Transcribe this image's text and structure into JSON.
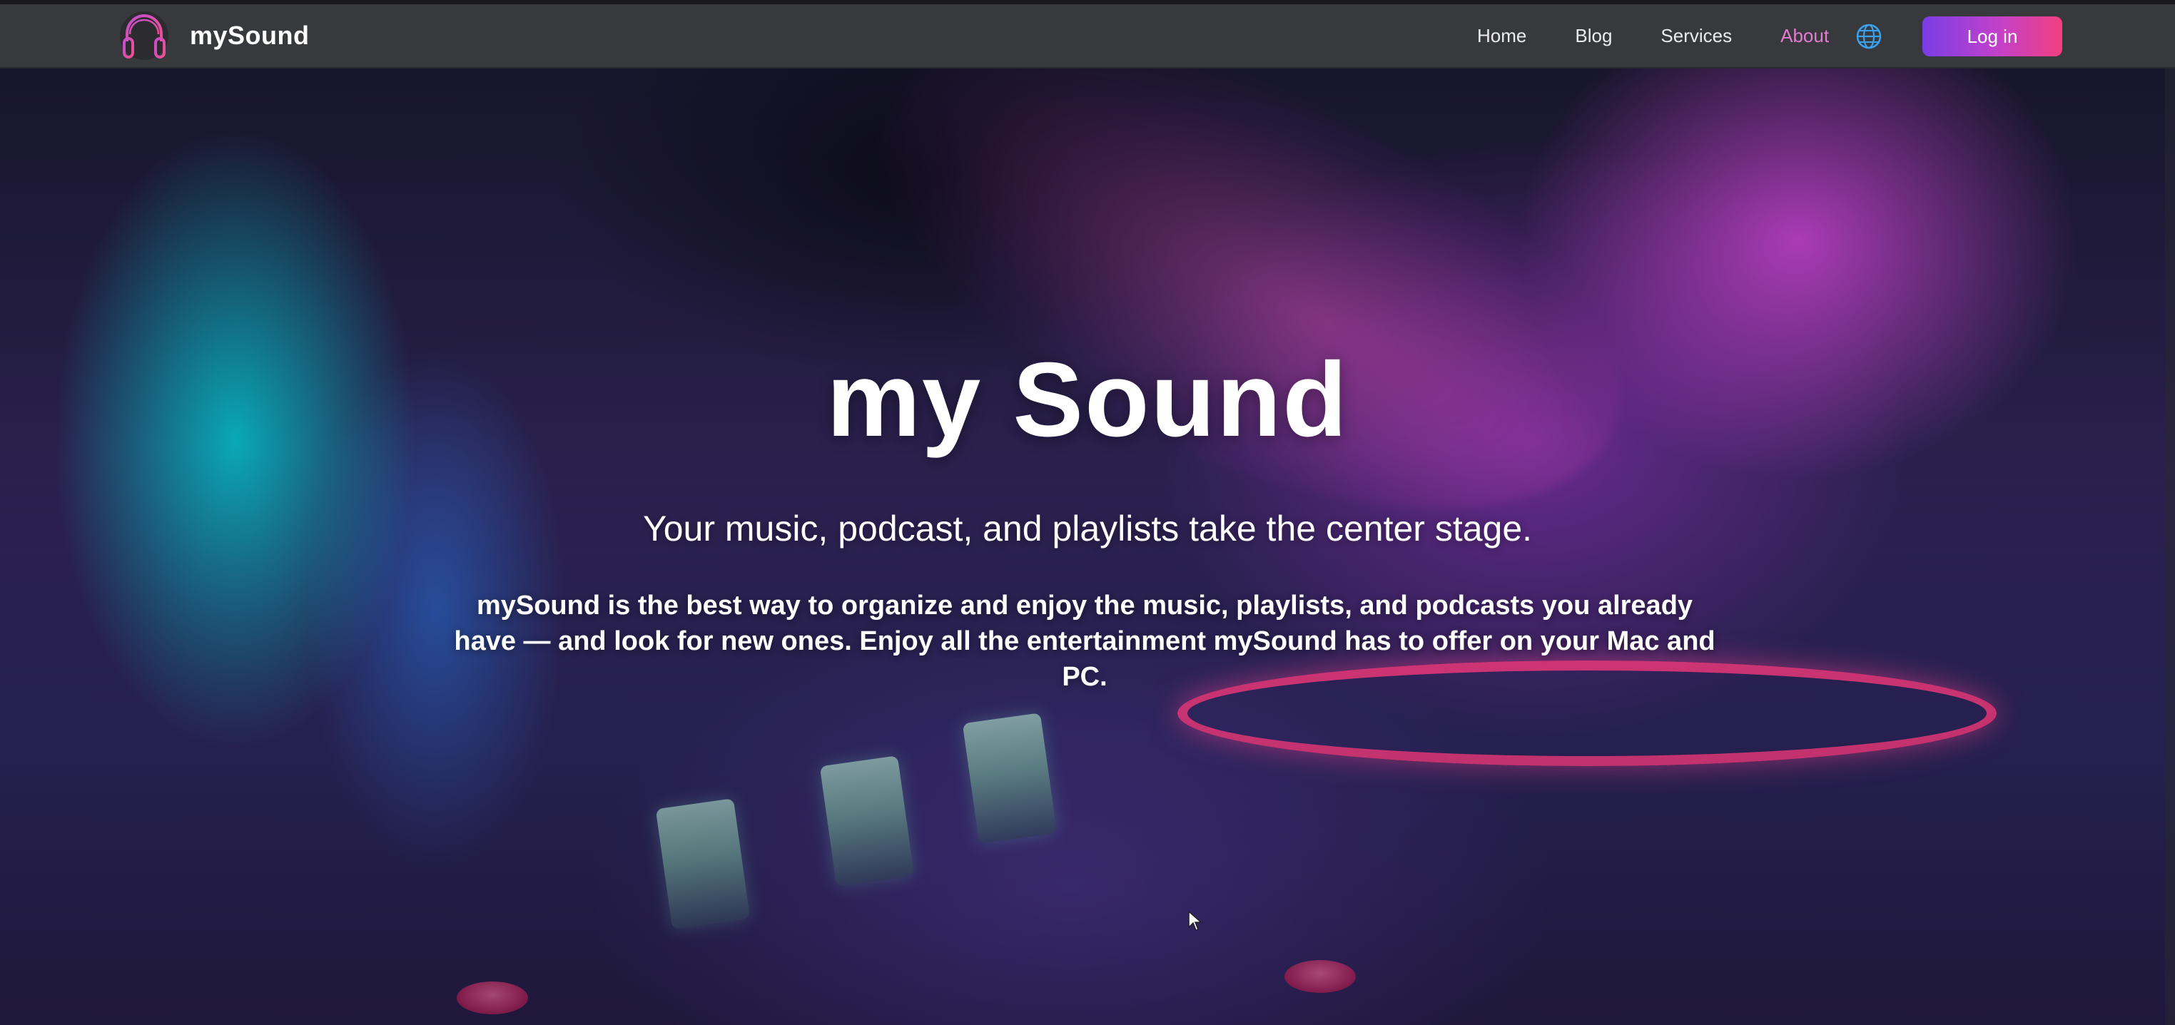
{
  "app": {
    "brand_name": "mySound",
    "brand_color": "#e060c8",
    "accent_active": "#e27bd3"
  },
  "nav": {
    "items": [
      {
        "label": "Home",
        "active": false
      },
      {
        "label": "Blog",
        "active": false
      },
      {
        "label": "Services",
        "active": false
      },
      {
        "label": "About",
        "active": true
      }
    ],
    "language_icon": "globe-icon",
    "login_label": "Log in"
  },
  "hero": {
    "title": "my Sound",
    "subtitle": "Your music, podcast, and playlists take the center stage.",
    "description": "mySound is the best way to organize and enjoy the music, playlists, and podcasts you already have — and look for new ones. Enjoy all the entertainment mySound has to offer on your Mac and PC."
  }
}
